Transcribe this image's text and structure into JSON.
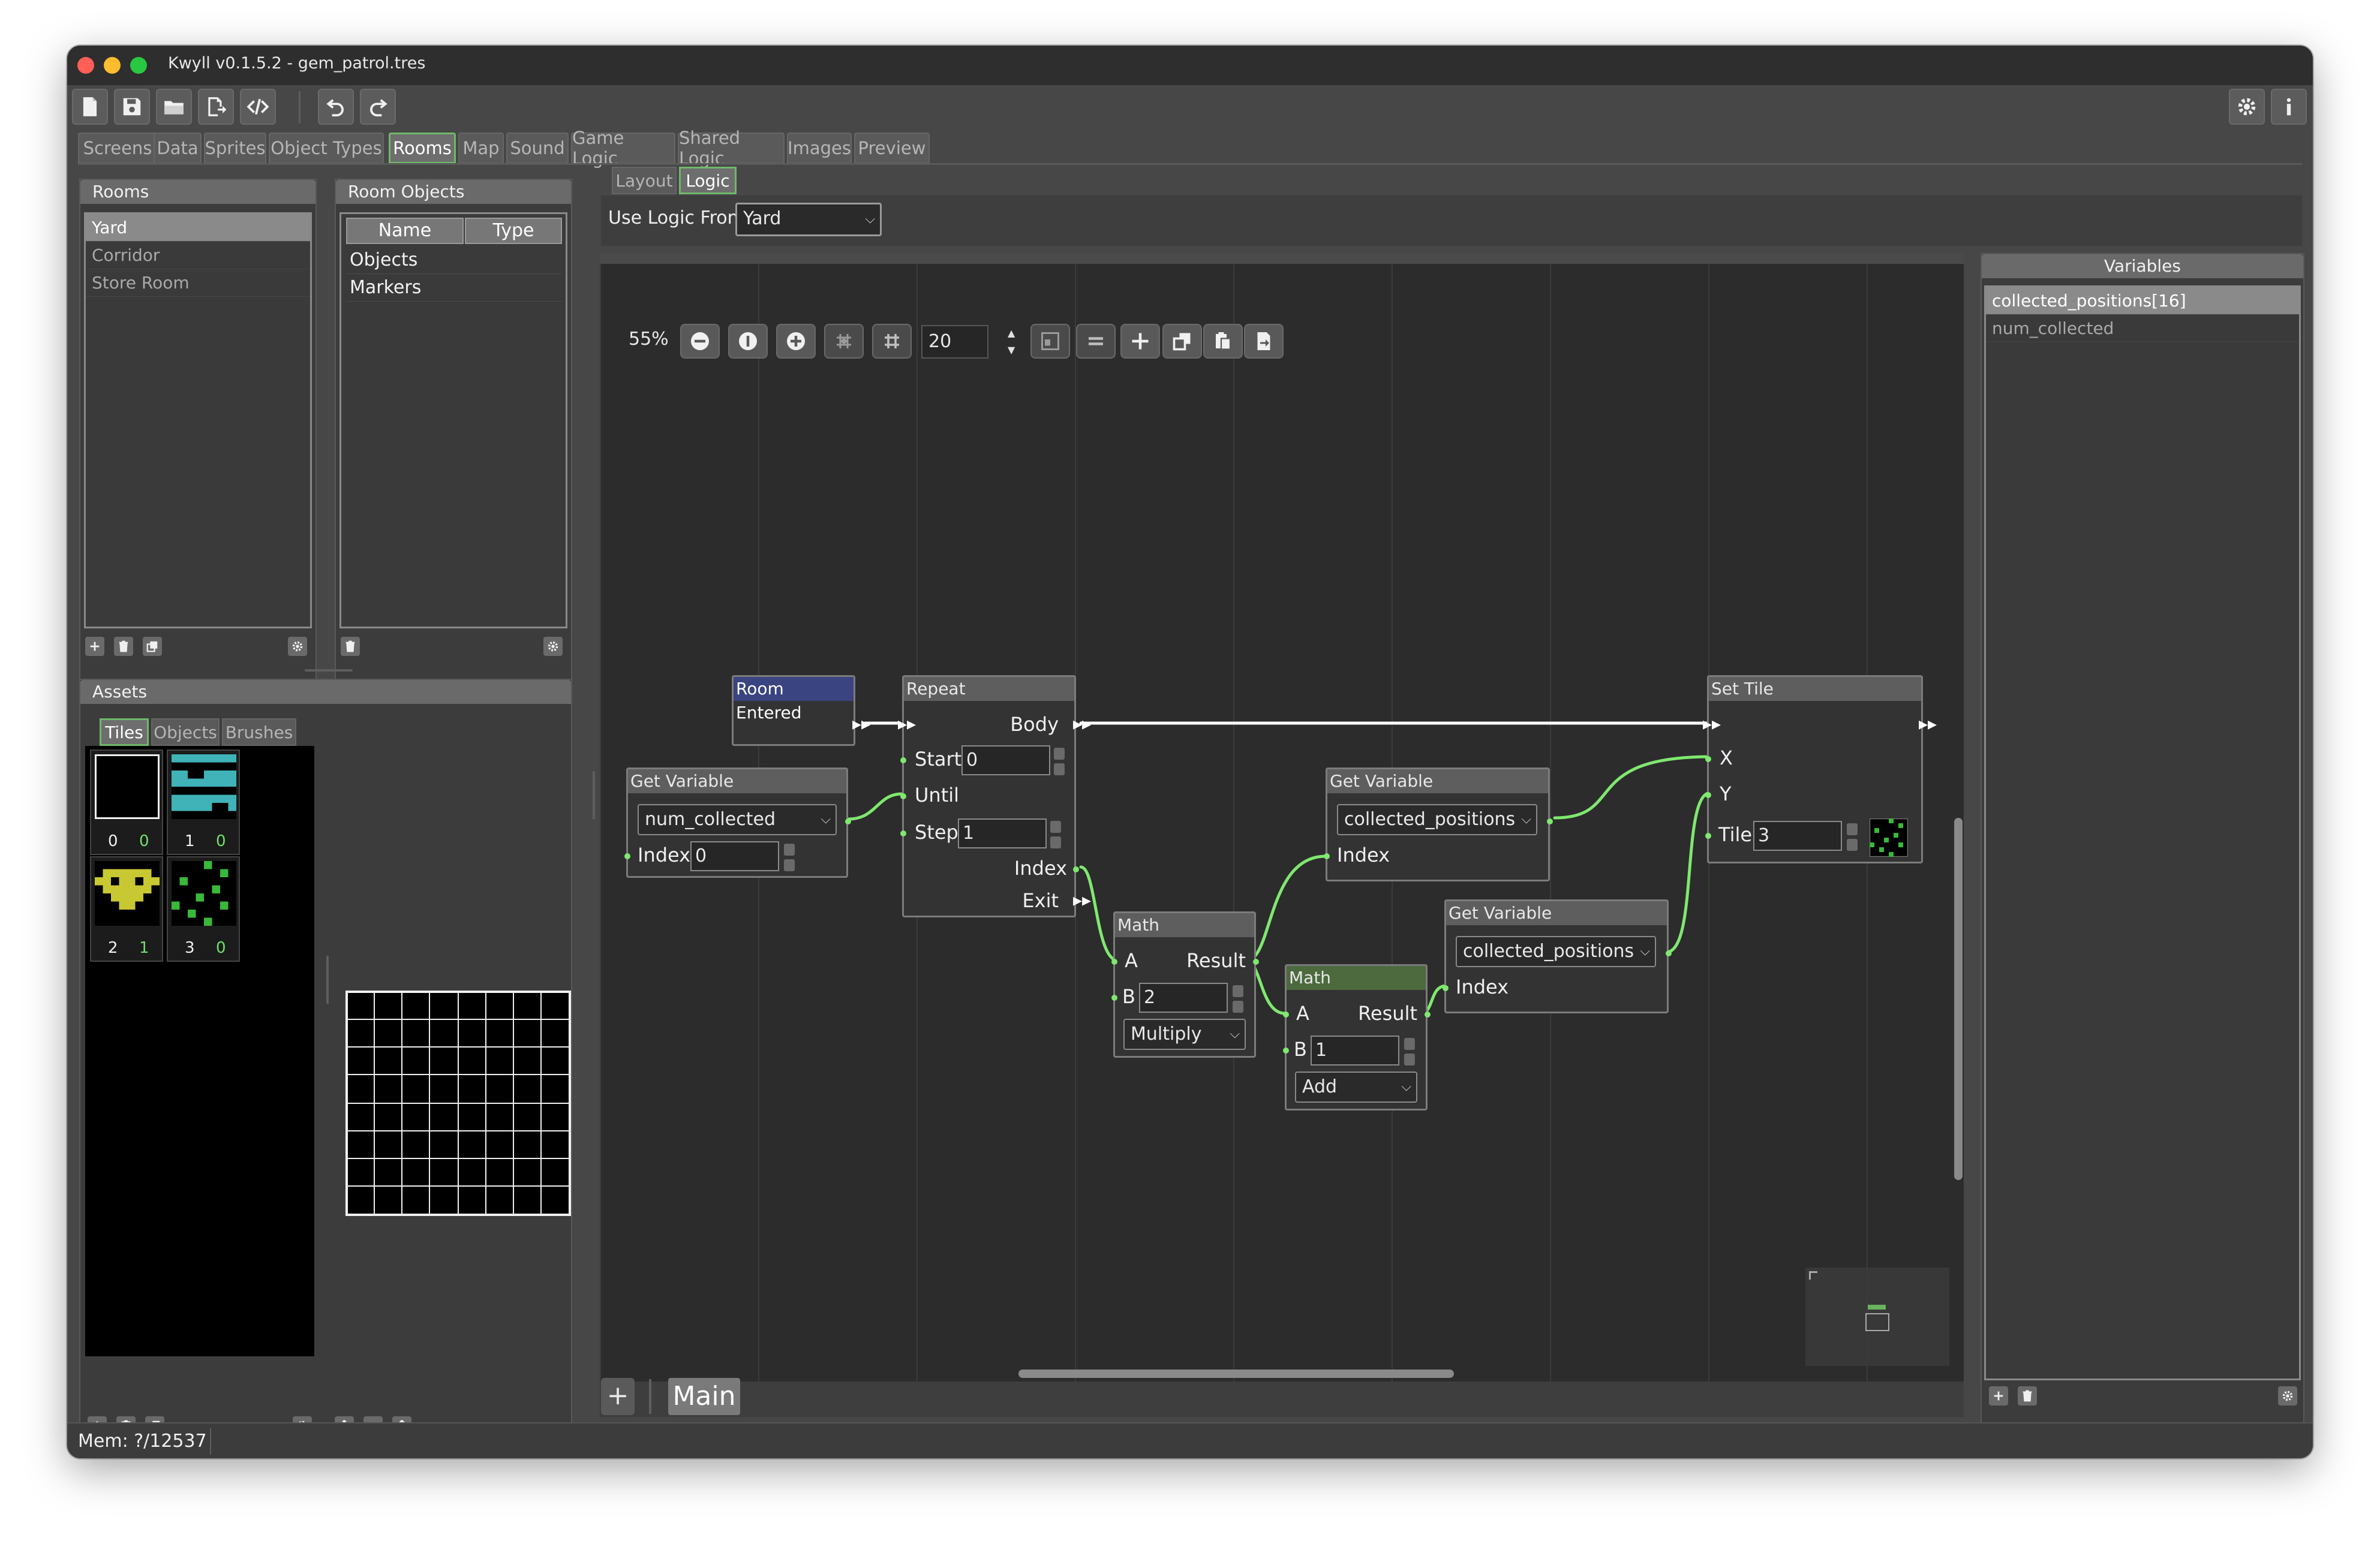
{
  "window": {
    "title": "Kwyll v0.1.5.2 - gem_patrol.tres"
  },
  "toolbar": {
    "buttons": [
      "new-file-icon",
      "save-icon",
      "open-folder-icon",
      "export-icon",
      "code-icon",
      "undo-icon",
      "redo-icon"
    ],
    "right_buttons": [
      "settings-icon",
      "info-icon"
    ]
  },
  "main_tabs": [
    "Screens",
    "Data",
    "Sprites",
    "Object Types",
    "Rooms",
    "Map",
    "Sound",
    "Game Logic",
    "Shared Logic",
    "Images",
    "Preview"
  ],
  "main_tabs_active": "Rooms",
  "rooms_panel": {
    "title": "Rooms",
    "items": [
      "Yard",
      "Corridor",
      "Store Room"
    ],
    "selected": "Yard"
  },
  "room_objects_panel": {
    "title": "Room Objects",
    "columns": [
      "Name",
      "Type"
    ],
    "rows": [
      "Objects",
      "Markers"
    ]
  },
  "assets_panel": {
    "title": "Assets",
    "tabs": [
      "Tiles",
      "Objects",
      "Brushes"
    ],
    "active_tab": "Tiles",
    "tiles": [
      {
        "index": "0",
        "count": "0"
      },
      {
        "index": "1",
        "count": "0"
      },
      {
        "index": "2",
        "count": "1"
      },
      {
        "index": "3",
        "count": "0"
      }
    ]
  },
  "room_view_tabs": [
    "Layout",
    "Logic"
  ],
  "room_view_active": "Logic",
  "use_logic_from": {
    "label": "Use Logic From",
    "value": "Yard"
  },
  "graph_toolbar": {
    "zoom": "55%",
    "snap_value": "20"
  },
  "nodes": {
    "room_entered": {
      "title": "Room Entered"
    },
    "repeat": {
      "title": "Repeat",
      "body": "Body",
      "start_label": "Start",
      "start_value": "0",
      "until": "Until",
      "step_label": "Step",
      "step_value": "1",
      "index": "Index",
      "exit": "Exit"
    },
    "get_var1": {
      "title": "Get Variable",
      "variable": "num_collected",
      "index_label": "Index",
      "index_value": "0"
    },
    "math1": {
      "title": "Math",
      "a": "A",
      "result": "Result",
      "b_label": "B",
      "b_value": "2",
      "op": "Multiply"
    },
    "get_var2": {
      "title": "Get Variable",
      "variable": "collected_positions",
      "index_label": "Index"
    },
    "math2": {
      "title": "Math",
      "a": "A",
      "result": "Result",
      "b_label": "B",
      "b_value": "1",
      "op": "Add"
    },
    "get_var3": {
      "title": "Get Variable",
      "variable": "collected_positions",
      "index_label": "Index"
    },
    "set_tile": {
      "title": "Set Tile",
      "x": "X",
      "y": "Y",
      "tile_label": "Tile",
      "tile_value": "3"
    }
  },
  "graph_tabs": {
    "add": "+",
    "main": "Main"
  },
  "variables_panel": {
    "title": "Variables",
    "items": [
      "collected_positions[16]",
      "num_collected"
    ],
    "selected": "collected_positions[16]"
  },
  "status_bar": {
    "mem": "Mem: ?/12537"
  },
  "colors": {
    "accent_green": "#6fb86b",
    "wire_green": "#7fe86f",
    "event_blue": "#3a4480",
    "tile_cyan": "#3fb3b8",
    "tile_yellow": "#c8c832",
    "tile_green": "#3ab83a"
  }
}
